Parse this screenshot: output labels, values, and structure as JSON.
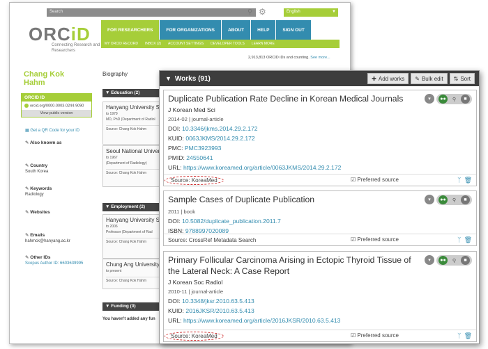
{
  "header": {
    "search_placeholder": "Search",
    "language": "English",
    "logo_text_main": "ORC",
    "logo_text_id": "iD",
    "tagline": "Connecting Research and Researchers",
    "nav": [
      "FOR RESEARCHERS",
      "FOR ORGANIZATIONS",
      "ABOUT",
      "HELP",
      "SIGN OUT"
    ],
    "subnav": [
      "MY ORCID RECORD",
      "INBOX (2)",
      "ACCOUNT SETTINGS",
      "DEVELOPER TOOLS",
      "LEARN MORE"
    ],
    "counts_text": "2,913,813 ORCID iDs and counting.",
    "see_more": "See more..."
  },
  "sidebar": {
    "name": "Chang Kok Hahm",
    "orcid_id_label": "ORCID ID",
    "orcid_id_url": "orcid.org/0000-0003-0244-9090",
    "view_public": "View public version",
    "qr_code": "Get a QR Code for your iD",
    "also_known_as": "Also known as",
    "country_label": "Country",
    "country_value": "South Korea",
    "keywords_label": "Keywords",
    "keywords_value": "Radiology",
    "websites_label": "Websites",
    "emails_label": "Emails",
    "emails_value": "hahmck@hanyang.ac.kr",
    "other_ids_label": "Other IDs",
    "other_ids_value": "Scopus Author ID: 6603639995"
  },
  "main_bg": {
    "biography": "Biography",
    "education_head": "Education (2)",
    "education": [
      {
        "title": "Hanyang University S",
        "date": "to 1979",
        "role": "MD, PhD (Department of Radiol",
        "source": "Source: Chang Kok Hahm"
      },
      {
        "title": "Seoul National Univer",
        "date": "to 1967",
        "role": "(Department of Radiology)",
        "source": "Source: Chang Kok Hahm"
      }
    ],
    "employment_head": "Employment (2)",
    "employment": [
      {
        "title": "Hanyang University S",
        "date": "to 2006",
        "role": "Professor (Department of Rad",
        "source": "Source: Chang Kok Hahm"
      },
      {
        "title": "Chung Ang University",
        "date": "to present",
        "role": "",
        "source": "Source: Chang Kok Hahm"
      }
    ],
    "funding_head": "Funding (0)",
    "no_funding": "You haven't added any fun"
  },
  "works": {
    "title": "Works (91)",
    "add_works": "Add works",
    "bulk_edit": "Bulk edit",
    "sort": "Sort",
    "items": [
      {
        "title": "Duplicate Publication Rate Decline in Korean Medical Journals",
        "journal": "J Korean Med Sci",
        "meta": "2014-02 | journal-article",
        "ids": [
          {
            "label": "DOI: ",
            "value": "10.3346/jkms.2014.29.2.172"
          },
          {
            "label": "KUID: ",
            "value": "0063JKMS/2014.29.2.172"
          },
          {
            "label": "PMC: ",
            "value": "PMC3923993"
          },
          {
            "label": "PMID: ",
            "value": "24550641"
          },
          {
            "label": "URL: ",
            "value": "https://www.koreamed.org/article/0063JKMS/2014.29.2.172"
          }
        ],
        "source": "Source: KoreaMed",
        "preferred": "Preferred source"
      },
      {
        "title": "Sample Cases of Duplicate Publication",
        "meta": "2011 | book",
        "ids": [
          {
            "label": "DOI: ",
            "value": "10.5082/duplicate_publication.2011.7"
          },
          {
            "label": "ISBN: ",
            "value": "9788997020089"
          }
        ],
        "source": "Source: CrossRef Metadata Search",
        "preferred": "Preferred source"
      },
      {
        "title": "Primary Follicular Carcinoma Arising in Ectopic Thyroid Tissue of the Lateral Neck: A Case Report",
        "journal": "J Korean Soc Radiol",
        "meta": "2010-11 | journal-article",
        "ids": [
          {
            "label": "DOI: ",
            "value": "10.3348/jksr.2010.63.5.413"
          },
          {
            "label": "KUID: ",
            "value": "2016JKSR/2010.63.5.413"
          },
          {
            "label": "URL: ",
            "value": "https://www.koreamed.org/article/2016JKSR/2010.63.5.413"
          }
        ],
        "source": "Source: KoreaMed",
        "preferred": "Preferred source"
      }
    ]
  }
}
